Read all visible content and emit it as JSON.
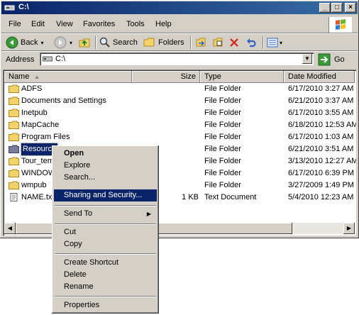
{
  "window": {
    "title": "C:\\"
  },
  "menu": [
    "File",
    "Edit",
    "View",
    "Favorites",
    "Tools",
    "Help"
  ],
  "toolbar": {
    "back": "Back",
    "search": "Search",
    "folders": "Folders"
  },
  "address": {
    "label": "Address",
    "value": "C:\\",
    "go": "Go"
  },
  "columns": {
    "name": "Name",
    "size": "Size",
    "type": "Type",
    "modified": "Date Modified"
  },
  "files": [
    {
      "name": "ADFS",
      "size": "",
      "type": "File Folder",
      "modified": "6/17/2010 3:27 AM"
    },
    {
      "name": "Documents and Settings",
      "size": "",
      "type": "File Folder",
      "modified": "6/21/2010 3:37 AM"
    },
    {
      "name": "Inetpub",
      "size": "",
      "type": "File Folder",
      "modified": "6/17/2010 3:55 AM"
    },
    {
      "name": "MapCache",
      "size": "",
      "type": "File Folder",
      "modified": "6/18/2010 12:53 AM"
    },
    {
      "name": "Program Files",
      "size": "",
      "type": "File Folder",
      "modified": "6/17/2010 1:03 AM"
    },
    {
      "name": "Resource",
      "size": "",
      "type": "File Folder",
      "modified": "6/21/2010 3:51 AM"
    },
    {
      "name": "Tour_tem",
      "size": "",
      "type": "File Folder",
      "modified": "3/13/2010 12:27 AM"
    },
    {
      "name": "WINDOW",
      "size": "",
      "type": "File Folder",
      "modified": "6/17/2010 6:39 PM"
    },
    {
      "name": "wmpub",
      "size": "",
      "type": "File Folder",
      "modified": "3/27/2009 1:49 PM"
    },
    {
      "name": "NAME.txt",
      "size": "1 KB",
      "type": "Text Document",
      "modified": "5/4/2010 12:23 AM"
    }
  ],
  "context_menu": {
    "open": "Open",
    "explore": "Explore",
    "search": "Search...",
    "sharing": "Sharing and Security...",
    "send_to": "Send To",
    "cut": "Cut",
    "copy": "Copy",
    "create_shortcut": "Create Shortcut",
    "delete": "Delete",
    "rename": "Rename",
    "properties": "Properties"
  },
  "colors": {
    "titlebar": "#0a246a",
    "highlight": "#0a246a",
    "face": "#d4d0c8"
  }
}
